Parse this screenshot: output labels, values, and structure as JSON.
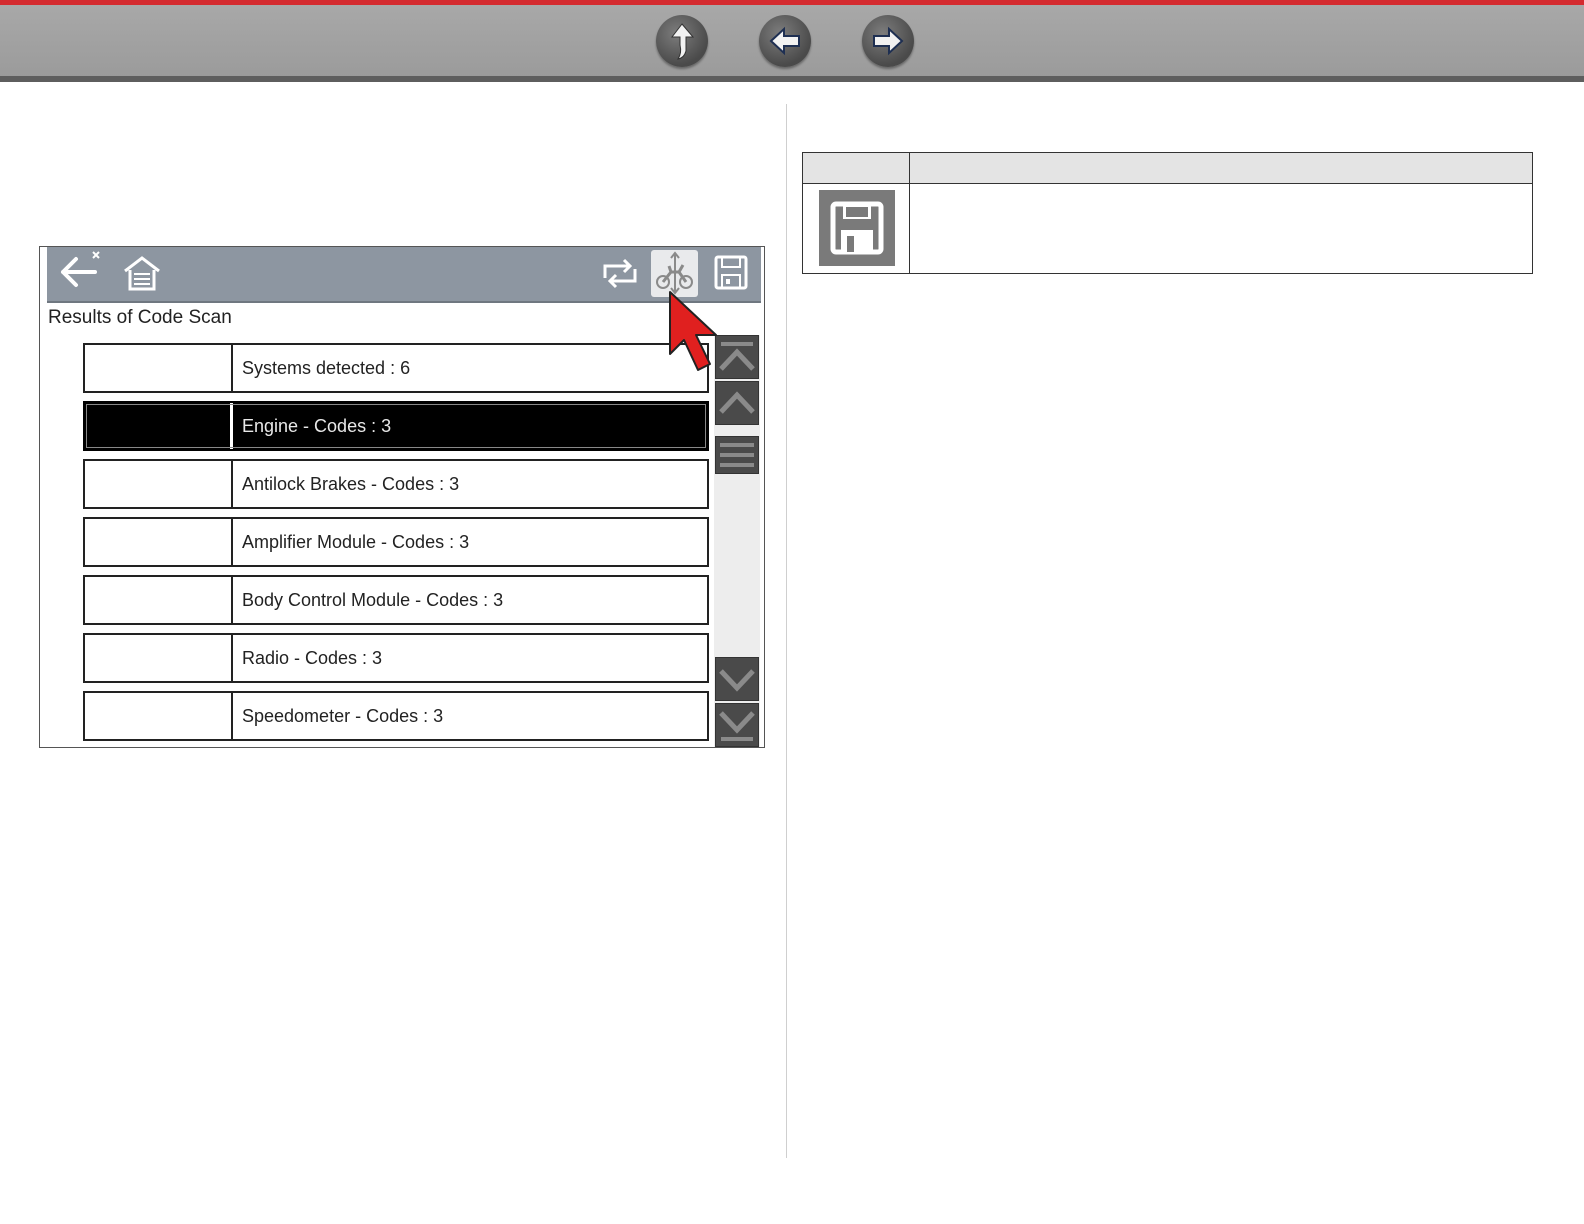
{
  "topbar": {
    "buttons": [
      {
        "name": "up",
        "icon": "up-arrow-icon"
      },
      {
        "name": "back",
        "icon": "left-arrow-icon"
      },
      {
        "name": "forward",
        "icon": "right-arrow-icon"
      }
    ],
    "accent_color": "#d42a2f"
  },
  "device": {
    "toolbar": {
      "icons": [
        "back-close-icon",
        "garage-home-icon",
        "refresh-icon",
        "vehicle-system-icon",
        "save-icon"
      ],
      "active_icon": "vehicle-system-icon"
    },
    "screen_title": "Results of Code Scan",
    "rows": [
      {
        "label": "Systems detected : 6",
        "selected": false
      },
      {
        "label": "Engine - Codes : 3",
        "selected": true
      },
      {
        "label": "Antilock Brakes - Codes : 3",
        "selected": false
      },
      {
        "label": "Amplifier Module - Codes : 3",
        "selected": false
      },
      {
        "label": "Body Control Module - Codes : 3",
        "selected": false
      },
      {
        "label": "Radio - Codes : 3",
        "selected": false
      },
      {
        "label": "Speedometer - Codes : 3",
        "selected": false
      }
    ],
    "scroll_buttons": [
      "scroll-top-icon",
      "scroll-up-icon",
      "scroll-menu-icon",
      "scroll-down-icon",
      "scroll-bottom-icon"
    ]
  },
  "ref_table": {
    "icon": "save-icon"
  }
}
